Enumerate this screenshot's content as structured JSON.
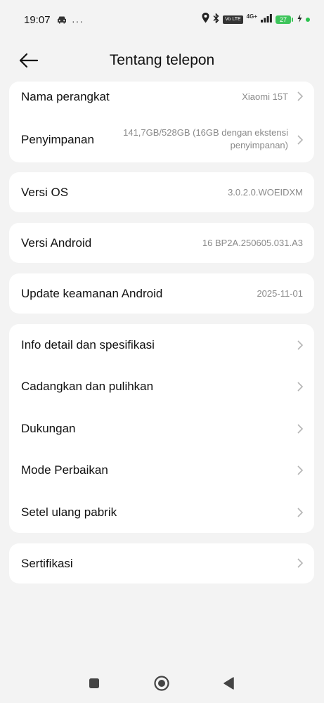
{
  "status_bar": {
    "time": "19:07",
    "overflow_dots": "···",
    "volte": "Vo LTE",
    "network": "4G+",
    "battery": "27"
  },
  "header": {
    "title": "Tentang telepon"
  },
  "device_card": {
    "name_label": "Nama perangkat",
    "name_value": "Xiaomi 15T",
    "storage_label": "Penyimpanan",
    "storage_value_line1": "141,7GB/528GB (16GB dengan ekstensi",
    "storage_value_line2": "penyimpanan)"
  },
  "os_card": {
    "label": "Versi OS",
    "value": "3.0.2.0.WOEIDXM"
  },
  "android_card": {
    "label": "Versi Android",
    "value": "16 BP2A.250605.031.A3"
  },
  "security_card": {
    "label": "Update keamanan Android",
    "value": "2025-11-01"
  },
  "menu_card": {
    "items": [
      {
        "label": "Info detail dan spesifikasi"
      },
      {
        "label": "Cadangkan dan pulihkan"
      },
      {
        "label": "Dukungan"
      },
      {
        "label": "Mode Perbaikan"
      },
      {
        "label": "Setel ulang pabrik"
      }
    ]
  },
  "cert_card": {
    "label": "Sertifikasi"
  },
  "colors": {
    "background": "#f3f3f3",
    "card": "#ffffff",
    "secondary_text": "#8a8a8a",
    "battery": "#3ec45b"
  }
}
